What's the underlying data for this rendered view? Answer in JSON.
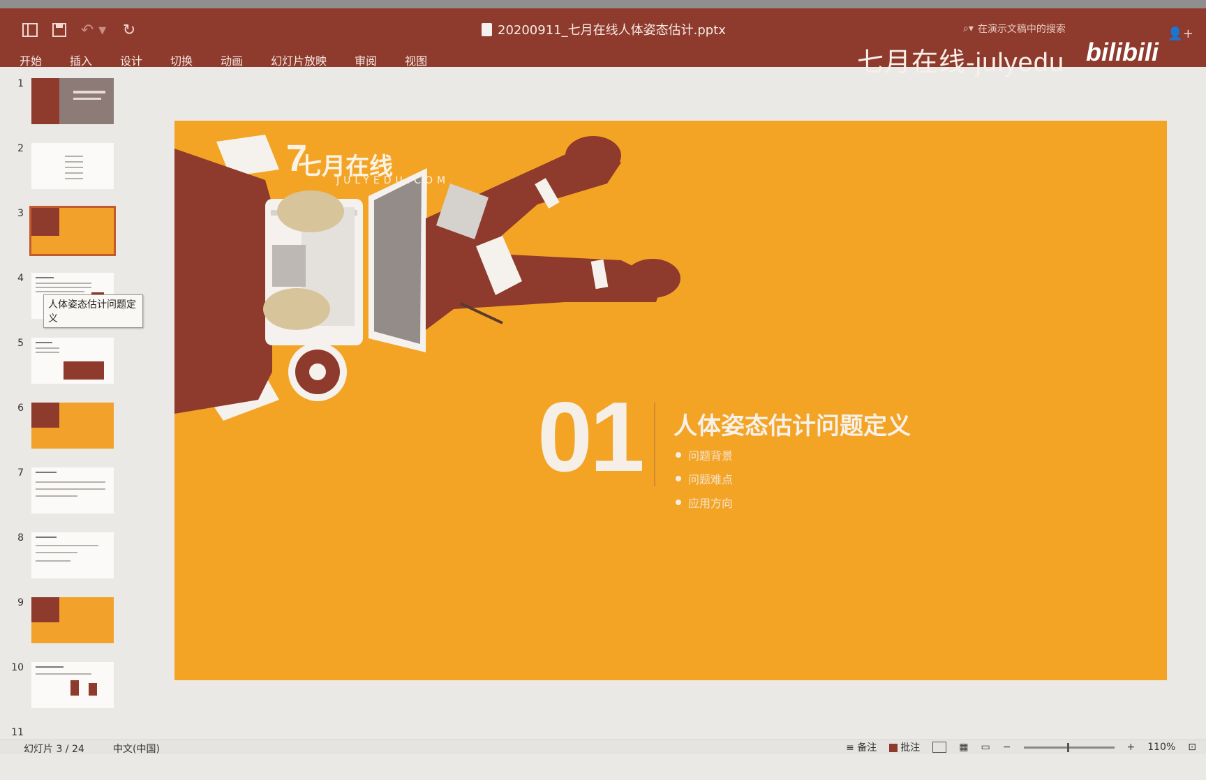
{
  "titlebar": {
    "filename": "20200911_七月在线人体姿态估计.pptx",
    "search_placeholder": "在演示文稿中的搜索",
    "brand": "七月在线-julyedu",
    "watermark": "bilibili"
  },
  "menu": [
    "开始",
    "插入",
    "设计",
    "切换",
    "动画",
    "幻灯片放映",
    "审阅",
    "视图"
  ],
  "sidebar": {
    "slides": [
      "1",
      "2",
      "3",
      "4",
      "5",
      "6",
      "7",
      "8",
      "9",
      "10",
      "11"
    ],
    "selected": 3,
    "tooltip": "人体姿态估计问题定义"
  },
  "slide": {
    "logo_text": "七月在线",
    "logo_sub": "JULYEDU.COM",
    "number": "01",
    "title": "人体姿态估计问题定义",
    "bullets": [
      "问题背景",
      "问题难点",
      "应用方向"
    ]
  },
  "status": {
    "slide_counter": "幻灯片 3 / 24",
    "language": "中文(中国)",
    "notes_label": "备注",
    "comments_label": "批注",
    "zoom": "110%"
  },
  "colors": {
    "accent": "#8e3a2c",
    "slide_bg": "#f4a425"
  }
}
